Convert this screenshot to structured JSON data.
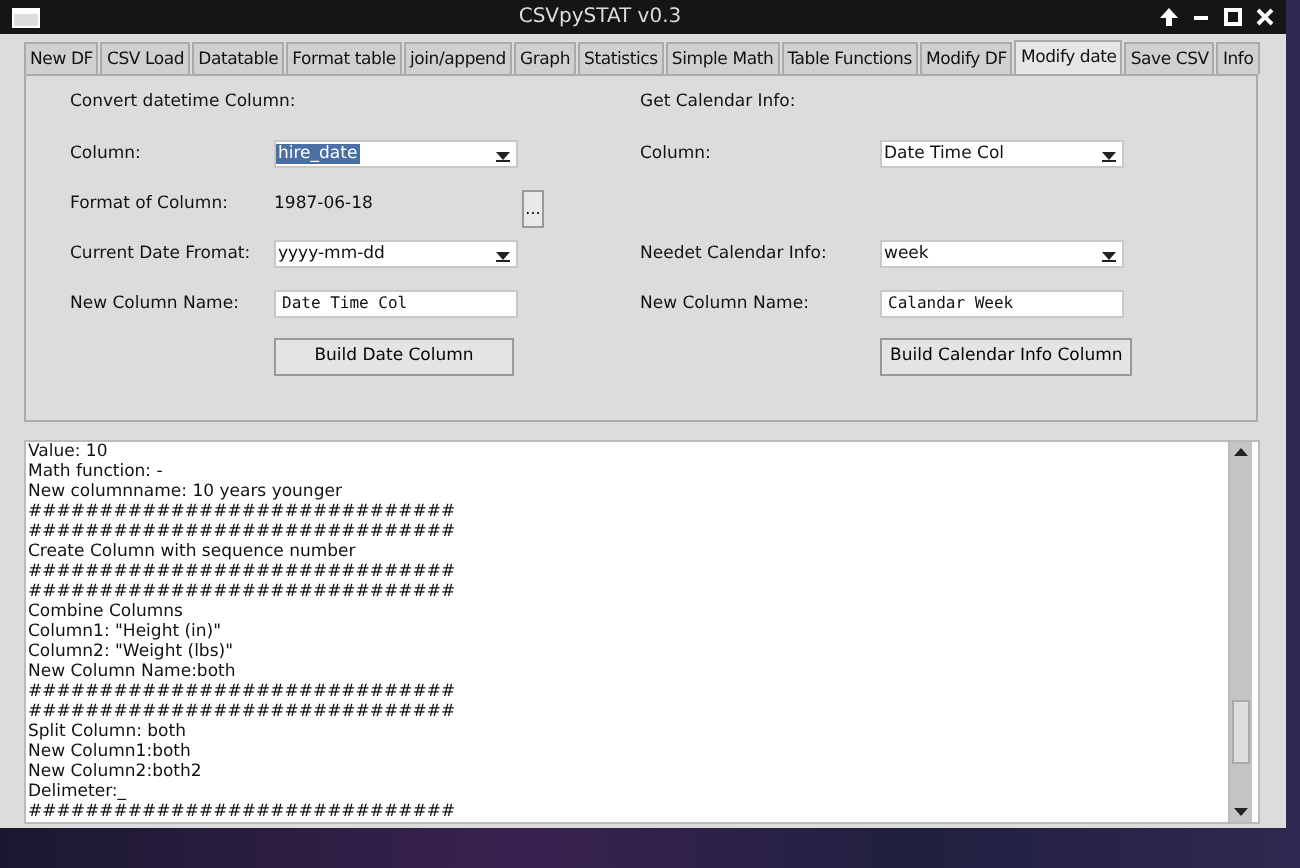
{
  "window": {
    "title": "CSVpySTAT v0.3"
  },
  "tabs": [
    {
      "label": "New DF",
      "selected": false
    },
    {
      "label": "CSV Load",
      "selected": false
    },
    {
      "label": "Datatable",
      "selected": false
    },
    {
      "label": "Format table",
      "selected": false
    },
    {
      "label": "join/append",
      "selected": false
    },
    {
      "label": "Graph",
      "selected": false
    },
    {
      "label": "Statistics",
      "selected": false
    },
    {
      "label": "Simple Math",
      "selected": false
    },
    {
      "label": "Table Functions",
      "selected": false
    },
    {
      "label": "Modify DF",
      "selected": false
    },
    {
      "label": "Modify date",
      "selected": true
    },
    {
      "label": "Save CSV",
      "selected": false
    },
    {
      "label": "Info",
      "selected": false
    }
  ],
  "convert": {
    "heading": "Convert datetime Column:",
    "rows": [
      {
        "kind": "combo",
        "label": "Column:",
        "value": "hire_date",
        "text_selected": true
      },
      {
        "kind": "static",
        "label": "Format of Column:",
        "value": "1987-06-18",
        "button": "..."
      },
      {
        "kind": "combo",
        "label": "Current Date Fromat:",
        "value": "yyyy-mm-dd",
        "text_selected": false
      },
      {
        "kind": "entry",
        "label": "New Column Name:",
        "value": "Date Time Col"
      }
    ],
    "button": "Build Date Column"
  },
  "calendar": {
    "heading": "Get Calendar Info:",
    "rows": [
      {
        "kind": "combo",
        "label": "Column:",
        "value": "Date Time Col",
        "text_selected": false
      },
      {
        "kind": "combo",
        "label": "Needet Calendar Info:",
        "value": "week",
        "text_selected": false
      },
      {
        "kind": "entry",
        "label": "New Column Name:",
        "value": "Calandar Week"
      }
    ],
    "button": "Build Calendar Info Column"
  },
  "log": {
    "lines": [
      "Value: 10",
      "Math function: -",
      "New columnname: 10 years younger",
      "##############################",
      "##############################",
      "Create Column with sequence number",
      "##############################",
      "##############################",
      "Combine Columns",
      "Column1: \"Height (in)\"",
      "Column2: \"Weight (lbs)\"",
      "New Column Name:both",
      "##############################",
      "##############################",
      "Split Column: both",
      "New Column1:both",
      "New Column2:both2",
      "Delimeter:_",
      "##############################"
    ]
  }
}
